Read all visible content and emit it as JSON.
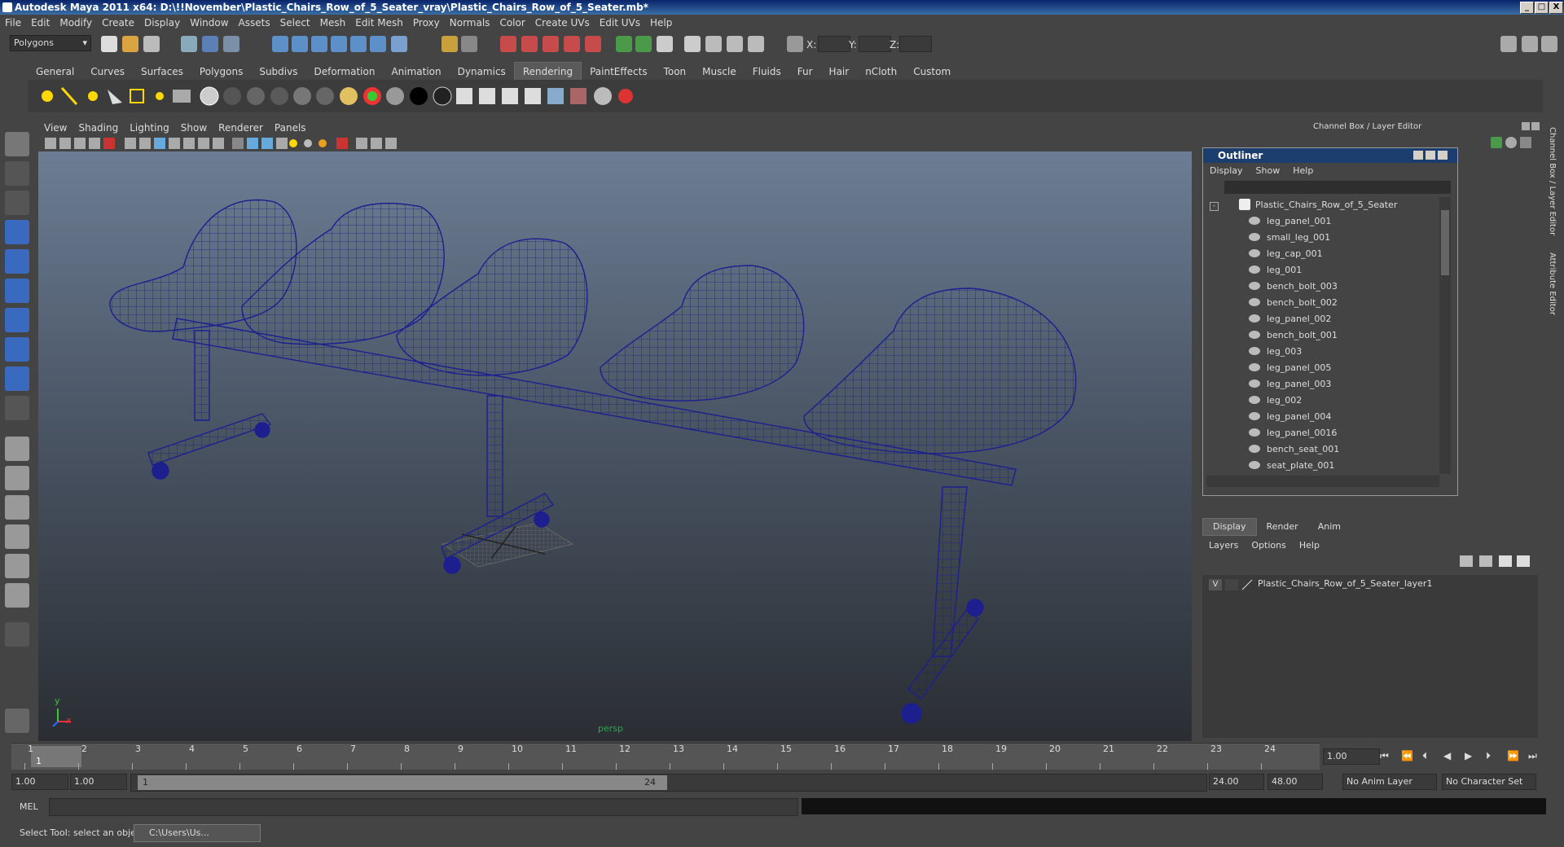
{
  "window": {
    "title": "Autodesk Maya 2011 x64: D:\\!!November\\Plastic_Chairs_Row_of_5_Seater_vray\\Plastic_Chairs_Row_of_5_Seater.mb*",
    "buttons": [
      "_",
      "□",
      "X"
    ]
  },
  "menubar": [
    "File",
    "Edit",
    "Modify",
    "Create",
    "Display",
    "Window",
    "Assets",
    "Select",
    "Mesh",
    "Edit Mesh",
    "Proxy",
    "Normals",
    "Color",
    "Create UVs",
    "Edit UVs",
    "Help"
  ],
  "statusline": {
    "mode_combo": "Polygons",
    "x_label": "X:",
    "y_label": "Y:",
    "z_label": "Z:"
  },
  "shelf": {
    "tabs": [
      "General",
      "Curves",
      "Surfaces",
      "Polygons",
      "Subdivs",
      "Deformation",
      "Animation",
      "Dynamics",
      "Rendering",
      "PaintEffects",
      "Toon",
      "Muscle",
      "Fluids",
      "Fur",
      "Hair",
      "nCloth",
      "Custom"
    ],
    "active_tab": "Rendering"
  },
  "viewport": {
    "menu": [
      "View",
      "Shading",
      "Lighting",
      "Show",
      "Renderer",
      "Panels"
    ],
    "camera_label": "persp",
    "axis_x": "x",
    "axis_y": "y"
  },
  "channel_box": {
    "header": "Channel Box / Layer Editor",
    "side_tab_1": "Channel Box / Layer Editor",
    "side_tab_2": "Attribute Editor"
  },
  "outliner": {
    "title": "Outliner",
    "menu": [
      "Display",
      "Show",
      "Help"
    ],
    "root": "Plastic_Chairs_Row_of_5_Seater",
    "items": [
      "leg_panel_001",
      "small_leg_001",
      "leg_cap_001",
      "leg_001",
      "bench_bolt_003",
      "bench_bolt_002",
      "leg_panel_002",
      "bench_bolt_001",
      "leg_003",
      "leg_panel_005",
      "leg_panel_003",
      "leg_002",
      "leg_panel_004",
      "leg_panel_0016",
      "bench_seat_001",
      "seat_plate_001"
    ]
  },
  "layer_editor": {
    "tabs": [
      "Display",
      "Render",
      "Anim"
    ],
    "active_tab": "Display",
    "menu": [
      "Layers",
      "Options",
      "Help"
    ],
    "layer_visible": "V",
    "layer_name": "Plastic_Chairs_Row_of_5_Seater_layer1"
  },
  "timeline": {
    "ticks": [
      "1",
      "2",
      "3",
      "4",
      "5",
      "6",
      "7",
      "8",
      "9",
      "10",
      "11",
      "12",
      "13",
      "14",
      "15",
      "16",
      "17",
      "18",
      "19",
      "20",
      "21",
      "22",
      "23",
      "24"
    ],
    "current_marker": "1",
    "current_frame": "1.00"
  },
  "range": {
    "start_time": "1.00",
    "playback_start": "1.00",
    "slider_start": "1",
    "slider_end": "24",
    "playback_end": "24.00",
    "end_time": "48.00",
    "anim_layer": "No Anim Layer",
    "character_set": "No Character Set"
  },
  "command": {
    "label": "MEL"
  },
  "helpline": {
    "text": "Select Tool: select an object",
    "task": "C:\\Users\\Us..."
  }
}
